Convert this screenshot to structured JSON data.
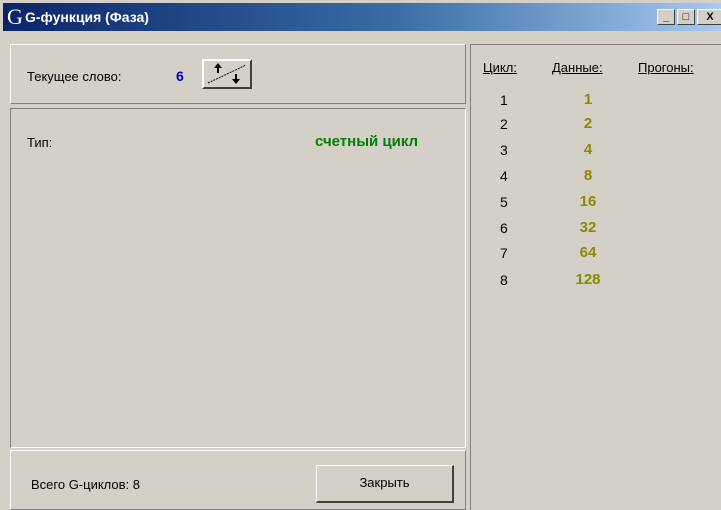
{
  "window": {
    "title": "G-функция (Фаза)",
    "logo": "G"
  },
  "titlebar_buttons": {
    "minimize": "_",
    "maximize": "□",
    "close": "X"
  },
  "current_word": {
    "label": "Текущее слово:",
    "value": "6"
  },
  "type": {
    "label": "Тип:",
    "value": "счетный цикл"
  },
  "footer": {
    "total_label": "Всего G-циклов: 8",
    "close_button": "Закрыть"
  },
  "table": {
    "headers": [
      "Цикл:",
      "Данные:",
      "Прогоны:"
    ],
    "rows": [
      {
        "cycle": "1",
        "data": "1"
      },
      {
        "cycle": "2",
        "data": "2"
      },
      {
        "cycle": "3",
        "data": "4"
      },
      {
        "cycle": "4",
        "data": "8"
      },
      {
        "cycle": "5",
        "data": "16"
      },
      {
        "cycle": "6",
        "data": "32"
      },
      {
        "cycle": "7",
        "data": "64"
      },
      {
        "cycle": "8",
        "data": "128"
      }
    ]
  },
  "colors": {
    "titlebar": "#0a246a",
    "current_value": "#0000c0",
    "type_value": "#008000",
    "data_values": "#8a8a00",
    "face": "#d4d0c8"
  },
  "icons": {
    "sort_button": "sort-up-down-icon"
  }
}
